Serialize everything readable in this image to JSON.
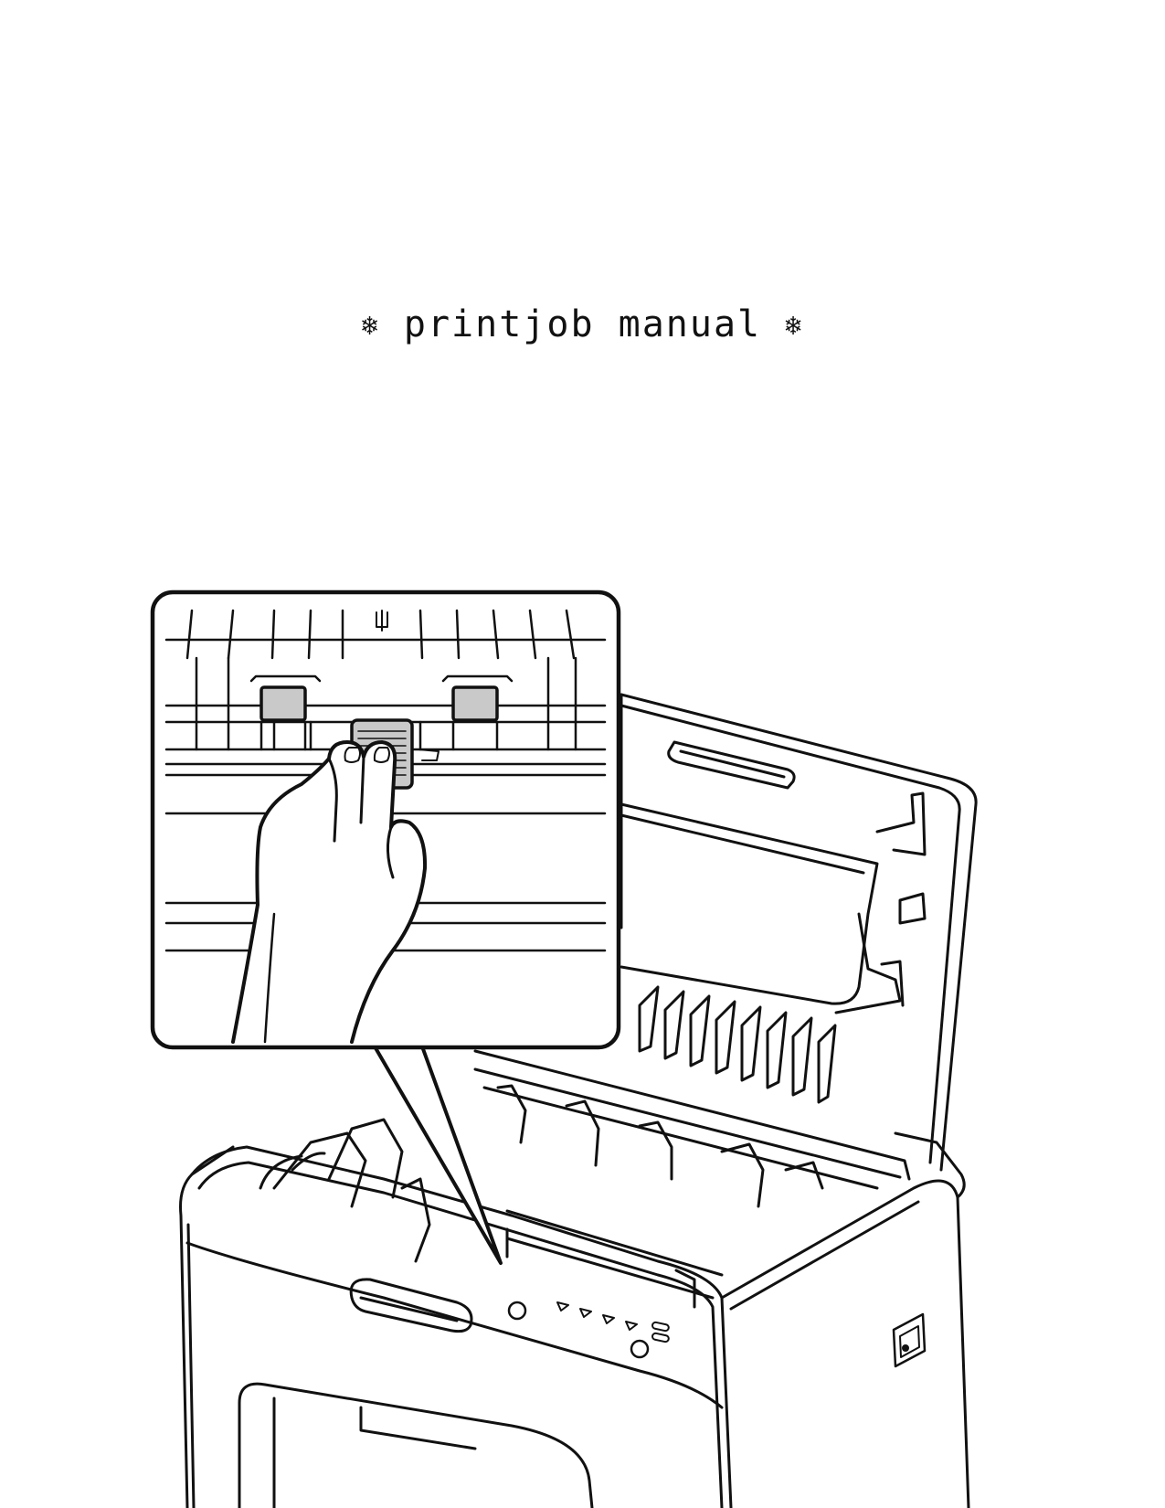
{
  "page": {
    "title": "printjob manual",
    "title_decoration": "❄"
  },
  "illustration": {
    "subject": "printer-open-top-cover",
    "callout_subject": "hand-cleaning-paper-feed-roller"
  }
}
